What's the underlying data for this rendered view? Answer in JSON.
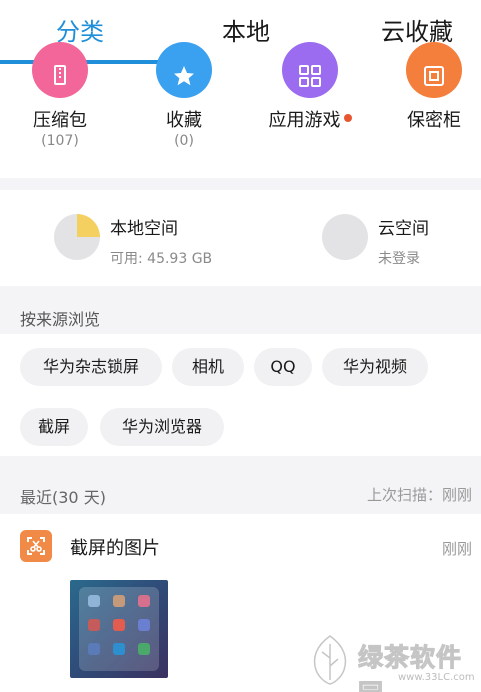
{
  "tabs": [
    {
      "label": "分类",
      "active": true
    },
    {
      "label": "本地",
      "active": false
    },
    {
      "label": "云收藏",
      "active": false
    }
  ],
  "categories": [
    {
      "label": "压缩包",
      "count": "(107)",
      "icon": "zip-icon",
      "color": "#f2669a"
    },
    {
      "label": "收藏",
      "count": "(0)",
      "icon": "star-icon",
      "color": "#3aa0f0"
    },
    {
      "label": "应用游戏",
      "count": "",
      "icon": "apps-icon",
      "color": "#9b6cf0",
      "badge": true
    },
    {
      "label": "保密柜",
      "count": "",
      "icon": "safe-icon",
      "color": "#f47e3c"
    }
  ],
  "storage": {
    "local": {
      "title": "本地空间",
      "sub": "可用: 45.93 GB",
      "used_fraction": 0.25
    },
    "cloud": {
      "title": "云空间",
      "sub": "未登录"
    }
  },
  "sources": {
    "heading": "按来源浏览",
    "chips": [
      "华为杂志锁屏",
      "相机",
      "QQ",
      "华为视频",
      "截屏",
      "华为浏览器"
    ]
  },
  "recent": {
    "label": "最近(30 天)",
    "scan": "上次扫描：刚刚",
    "album_name": "截屏的图片",
    "album_time": "刚刚"
  },
  "watermark": {
    "name": "绿茶软件园",
    "url": "www.33LC.com"
  },
  "colors": {
    "accent": "#1e8fd8",
    "background": "#f4f4f6"
  }
}
